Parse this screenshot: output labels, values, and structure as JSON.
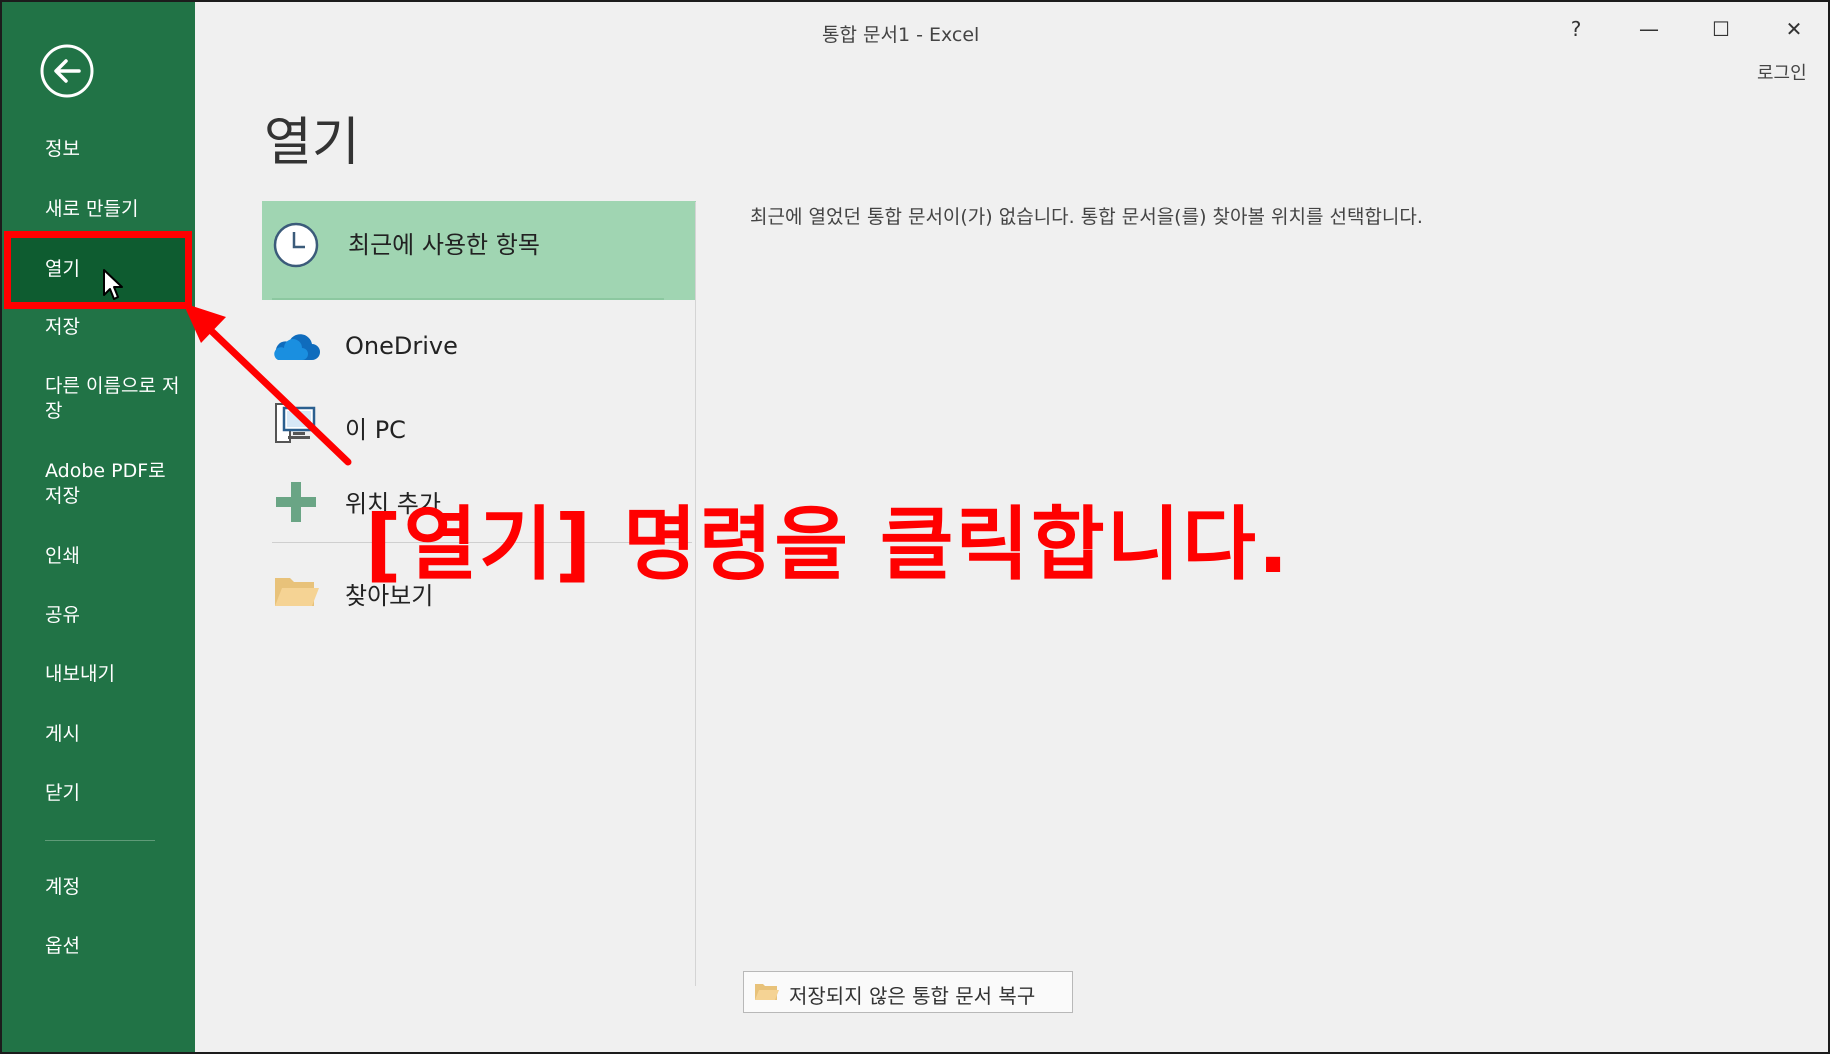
{
  "window": {
    "title": "통합 문서1 - Excel",
    "help": "?",
    "minimize": "—",
    "maximize": "☐",
    "close": "✕",
    "login": "로그인"
  },
  "sidebar": {
    "items": [
      {
        "label": "정보"
      },
      {
        "label": "새로 만들기"
      },
      {
        "label": "열기",
        "selected": true
      },
      {
        "label": "저장"
      },
      {
        "label": "다른 이름으로 저장"
      },
      {
        "label": "Adobe PDF로 저장"
      },
      {
        "label": "인쇄"
      },
      {
        "label": "공유"
      },
      {
        "label": "내보내기"
      },
      {
        "label": "게시"
      },
      {
        "label": "닫기"
      },
      {
        "label": "계정"
      },
      {
        "label": "옵션"
      }
    ]
  },
  "main": {
    "title": "열기",
    "locations": [
      {
        "label": "최근에 사용한 항목",
        "icon": "clock-icon",
        "selected": true
      },
      {
        "label": "OneDrive",
        "icon": "cloud-icon"
      },
      {
        "label": "이 PC",
        "icon": "computer-icon"
      },
      {
        "label": "위치 추가",
        "icon": "plus-icon"
      },
      {
        "label": "찾아보기",
        "icon": "folder-icon"
      }
    ],
    "message": "최근에 열었던 통합 문서이(가) 없습니다. 통합 문서을(를) 찾아볼 위치를 선택합니다.",
    "recover_button": "저장되지 않은 통합 문서 복구"
  },
  "annotation": {
    "text": "[열기] 명령을 클릭합니다."
  },
  "colors": {
    "sidebar": "#217346",
    "sidebar_selected": "#0e5c30",
    "location_selected": "#a0d5b2",
    "annotation": "#ff0000",
    "background": "#f0f0f0"
  }
}
